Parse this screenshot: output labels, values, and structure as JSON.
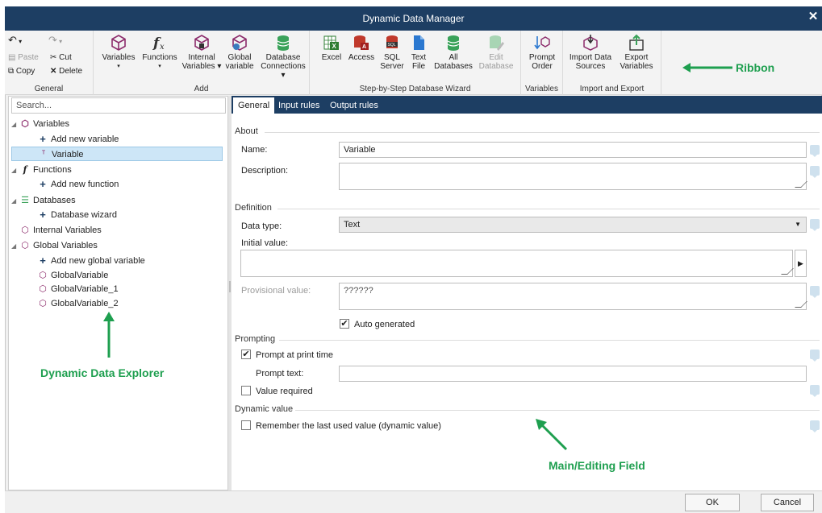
{
  "window": {
    "title": "Dynamic Data Manager"
  },
  "ribbon": {
    "general": {
      "caption": "General",
      "paste": "Paste",
      "cut": "Cut",
      "copy": "Copy",
      "delete": "Delete"
    },
    "add": {
      "caption": "Add",
      "variables": "Variables",
      "functions": "Functions",
      "internal_1": "Internal",
      "internal_2": "Variables",
      "global_1": "Global",
      "global_2": "variable",
      "db_1": "Database",
      "db_2": "Connections"
    },
    "wizard": {
      "caption": "Step-by-Step Database Wizard",
      "excel": "Excel",
      "access": "Access",
      "sql_1": "SQL",
      "sql_2": "Server",
      "text_1": "Text",
      "text_2": "File",
      "all_1": "All",
      "all_2": "Databases",
      "edit_1": "Edit",
      "edit_2": "Database"
    },
    "variables_group": {
      "caption": "Variables",
      "prompt_1": "Prompt",
      "prompt_2": "Order"
    },
    "import_export": {
      "caption": "Import and Export",
      "import_1": "Import Data",
      "import_2": "Sources",
      "export_1": "Export",
      "export_2": "Variables"
    }
  },
  "callouts": {
    "ribbon": "Ribbon",
    "explorer": "Dynamic Data Explorer",
    "main": "Main/Editing Field"
  },
  "explorer": {
    "search_placeholder": "Search...",
    "items": [
      {
        "label": "Variables"
      },
      {
        "label": "Add new variable"
      },
      {
        "label": "Variable"
      },
      {
        "label": "Functions"
      },
      {
        "label": "Add new function"
      },
      {
        "label": "Databases"
      },
      {
        "label": "Database wizard"
      },
      {
        "label": "Internal Variables"
      },
      {
        "label": "Global Variables"
      },
      {
        "label": "Add new global variable"
      },
      {
        "label": "GlobalVariable"
      },
      {
        "label": "GlobalVariable_1"
      },
      {
        "label": "GlobalVariable_2"
      }
    ]
  },
  "tabs": [
    "General",
    "Input rules",
    "Output rules"
  ],
  "form": {
    "about": "About",
    "name_label": "Name:",
    "name_value": "Variable",
    "description_label": "Description:",
    "definition": "Definition",
    "data_type_label": "Data type:",
    "data_type_value": "Text",
    "initial_value_label": "Initial value:",
    "provisional_label": "Provisional value:",
    "provisional_value": "??????",
    "auto_generated": "Auto generated",
    "prompting": "Prompting",
    "prompt_at_print": "Prompt at print time",
    "prompt_text_label": "Prompt text:",
    "value_required": "Value required",
    "dynamic_value": "Dynamic value",
    "remember_last": "Remember the last used value (dynamic value)"
  },
  "buttons": {
    "ok": "OK",
    "cancel": "Cancel"
  },
  "colors": {
    "titlebar": "#1d3e63",
    "callout": "#1e9f4f",
    "selection": "#cde6f7"
  }
}
